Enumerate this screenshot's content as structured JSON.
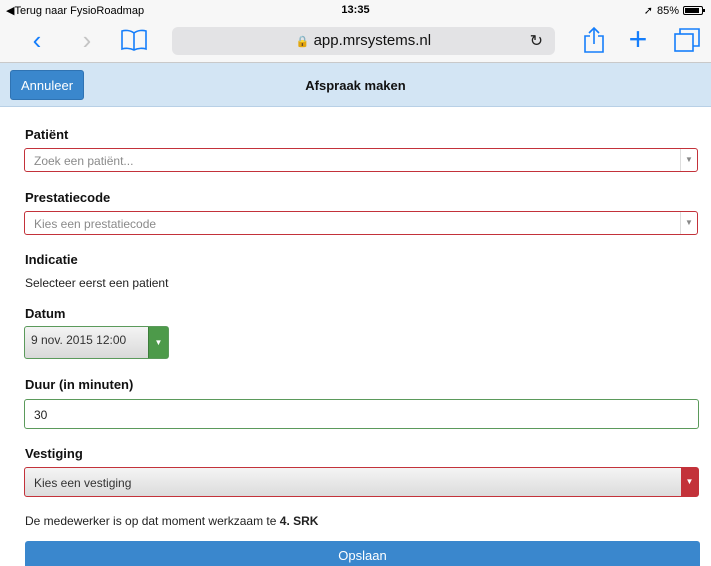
{
  "status_bar": {
    "back_app": "◀Terug naar FysioRoadmap",
    "time": "13:35",
    "location_icon": "location-arrow-icon",
    "battery": "85%",
    "battery_level": 0.85
  },
  "browser": {
    "url": "app.mrsystems.nl",
    "icons": [
      "back-icon",
      "forward-icon",
      "bookmarks-icon",
      "lock-icon",
      "reload-icon",
      "share-icon",
      "new-tab-icon",
      "tabs-icon"
    ]
  },
  "header": {
    "cancel_label": "Annuleer",
    "title": "Afspraak maken"
  },
  "form": {
    "patient": {
      "label": "Patiënt",
      "placeholder": "Zoek een patiënt..."
    },
    "prestatiecode": {
      "label": "Prestatiecode",
      "placeholder": "Kies een prestatiecode"
    },
    "indicatie": {
      "label": "Indicatie",
      "text": "Selecteer eerst een patient"
    },
    "datum": {
      "label": "Datum",
      "value": "9 nov. 2015 12:00"
    },
    "duur": {
      "label": "Duur (in minuten)",
      "value": "30"
    },
    "vestiging": {
      "label": "Vestiging",
      "value": "Kies een vestiging"
    },
    "info_prefix": "De medewerker is op dat moment werkzaam te ",
    "info_location": "4. SRK",
    "save_label": "Opslaan"
  },
  "colors": {
    "accent": "#3a87cd",
    "header_bg": "#d3e5f4",
    "error": "#c3323a",
    "valid": "#4d9a4a"
  }
}
